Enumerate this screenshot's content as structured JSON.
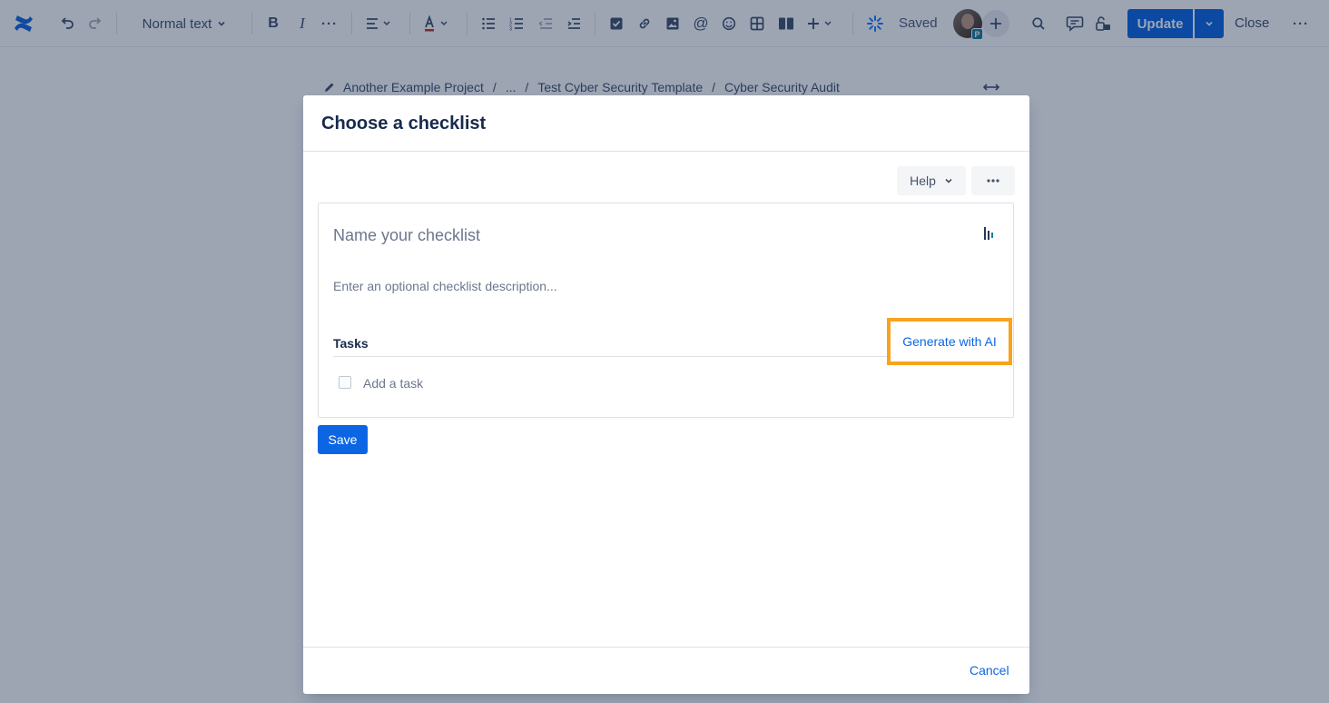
{
  "toolbar": {
    "text_style": "Normal text",
    "saved_label": "Saved",
    "avatar_badge": "P",
    "update_label": "Update",
    "close_label": "Close"
  },
  "breadcrumb": {
    "items": [
      "Another Example Project",
      "...",
      "Test Cyber Security Template",
      "Cyber Security Audit"
    ],
    "separator": "/"
  },
  "modal": {
    "title": "Choose a checklist",
    "help_label": "Help",
    "name_placeholder": "Name your checklist",
    "description_placeholder": "Enter an optional checklist description...",
    "tasks_label": "Tasks",
    "generate_ai_label": "Generate with AI",
    "add_task_label": "Add a task",
    "save_label": "Save",
    "cancel_label": "Cancel"
  },
  "colors": {
    "primary": "#0c66e4",
    "highlight": "#f8a31b",
    "overlay": "#091e42"
  },
  "icons": [
    "confluence-logo-icon",
    "undo-icon",
    "redo-icon",
    "bold-icon",
    "italic-icon",
    "more-formatting-icon",
    "align-icon",
    "text-color-icon",
    "bullet-list-icon",
    "numbered-list-icon",
    "outdent-icon",
    "indent-icon",
    "task-icon",
    "link-icon",
    "image-icon",
    "mention-icon",
    "emoji-icon",
    "table-icon",
    "layout-icon",
    "insert-icon",
    "loading-icon",
    "search-icon",
    "comment-icon",
    "restrictions-icon",
    "more-icon",
    "pencil-icon",
    "expand-width-icon",
    "checklist-app-icon"
  ]
}
